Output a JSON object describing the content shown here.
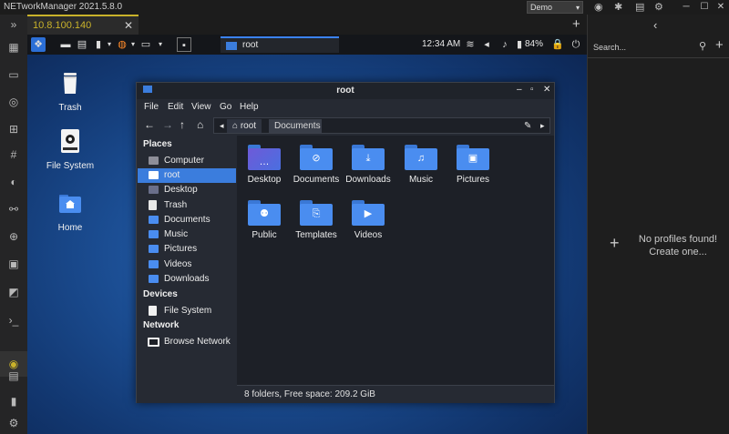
{
  "app": {
    "title": "NETworkManager 2021.5.8.0",
    "profile": "Demo"
  },
  "tabs": [
    {
      "label": "10.8.100.140",
      "close": "✕"
    }
  ],
  "tab_add": "+",
  "right_panel": {
    "back": "‹",
    "search_placeholder": "Search...",
    "search_icon": "⚲",
    "add": "+",
    "empty_plus": "+",
    "empty_line1": "No profiles found!",
    "empty_line2": "Create one..."
  },
  "remote": {
    "panel": {
      "window_label": "root",
      "clock": "12:34 AM",
      "battery": "84%"
    },
    "desktop_icons": [
      {
        "label": "Trash",
        "icon": "trash-icon"
      },
      {
        "label": "File System",
        "icon": "drive-icon"
      },
      {
        "label": "Home",
        "icon": "home-folder-icon"
      }
    ],
    "file_manager": {
      "title": "root",
      "menu": [
        "File",
        "Edit",
        "View",
        "Go",
        "Help"
      ],
      "breadcrumbs": [
        "root",
        "Documents"
      ],
      "sidebar": {
        "places_header": "Places",
        "places": [
          {
            "label": "Computer",
            "icon": "computer-icon"
          },
          {
            "label": "root",
            "icon": "home-icon",
            "selected": true
          },
          {
            "label": "Desktop",
            "icon": "desktop-icon"
          },
          {
            "label": "Trash",
            "icon": "trash-icon"
          },
          {
            "label": "Documents",
            "icon": "documents-icon"
          },
          {
            "label": "Music",
            "icon": "music-icon"
          },
          {
            "label": "Pictures",
            "icon": "pictures-icon"
          },
          {
            "label": "Videos",
            "icon": "videos-icon"
          },
          {
            "label": "Downloads",
            "icon": "downloads-icon"
          }
        ],
        "devices_header": "Devices",
        "devices": [
          {
            "label": "File System",
            "icon": "drive-icon"
          }
        ],
        "network_header": "Network",
        "network": [
          {
            "label": "Browse Network",
            "icon": "network-icon"
          }
        ]
      },
      "folders": [
        {
          "label": "Desktop",
          "icon": "desktop-folder-icon"
        },
        {
          "label": "Documents",
          "icon": "documents-folder-icon"
        },
        {
          "label": "Downloads",
          "icon": "downloads-folder-icon"
        },
        {
          "label": "Music",
          "icon": "music-folder-icon"
        },
        {
          "label": "Pictures",
          "icon": "pictures-folder-icon"
        },
        {
          "label": "Public",
          "icon": "public-folder-icon"
        },
        {
          "label": "Templates",
          "icon": "templates-folder-icon"
        },
        {
          "label": "Videos",
          "icon": "videos-folder-icon"
        }
      ],
      "status": "8 folders, Free space: 209.2 GiB"
    }
  },
  "colors": {
    "accent": "#c9b22a",
    "selection": "#3b7ddd",
    "folder": "#4a8df0"
  }
}
